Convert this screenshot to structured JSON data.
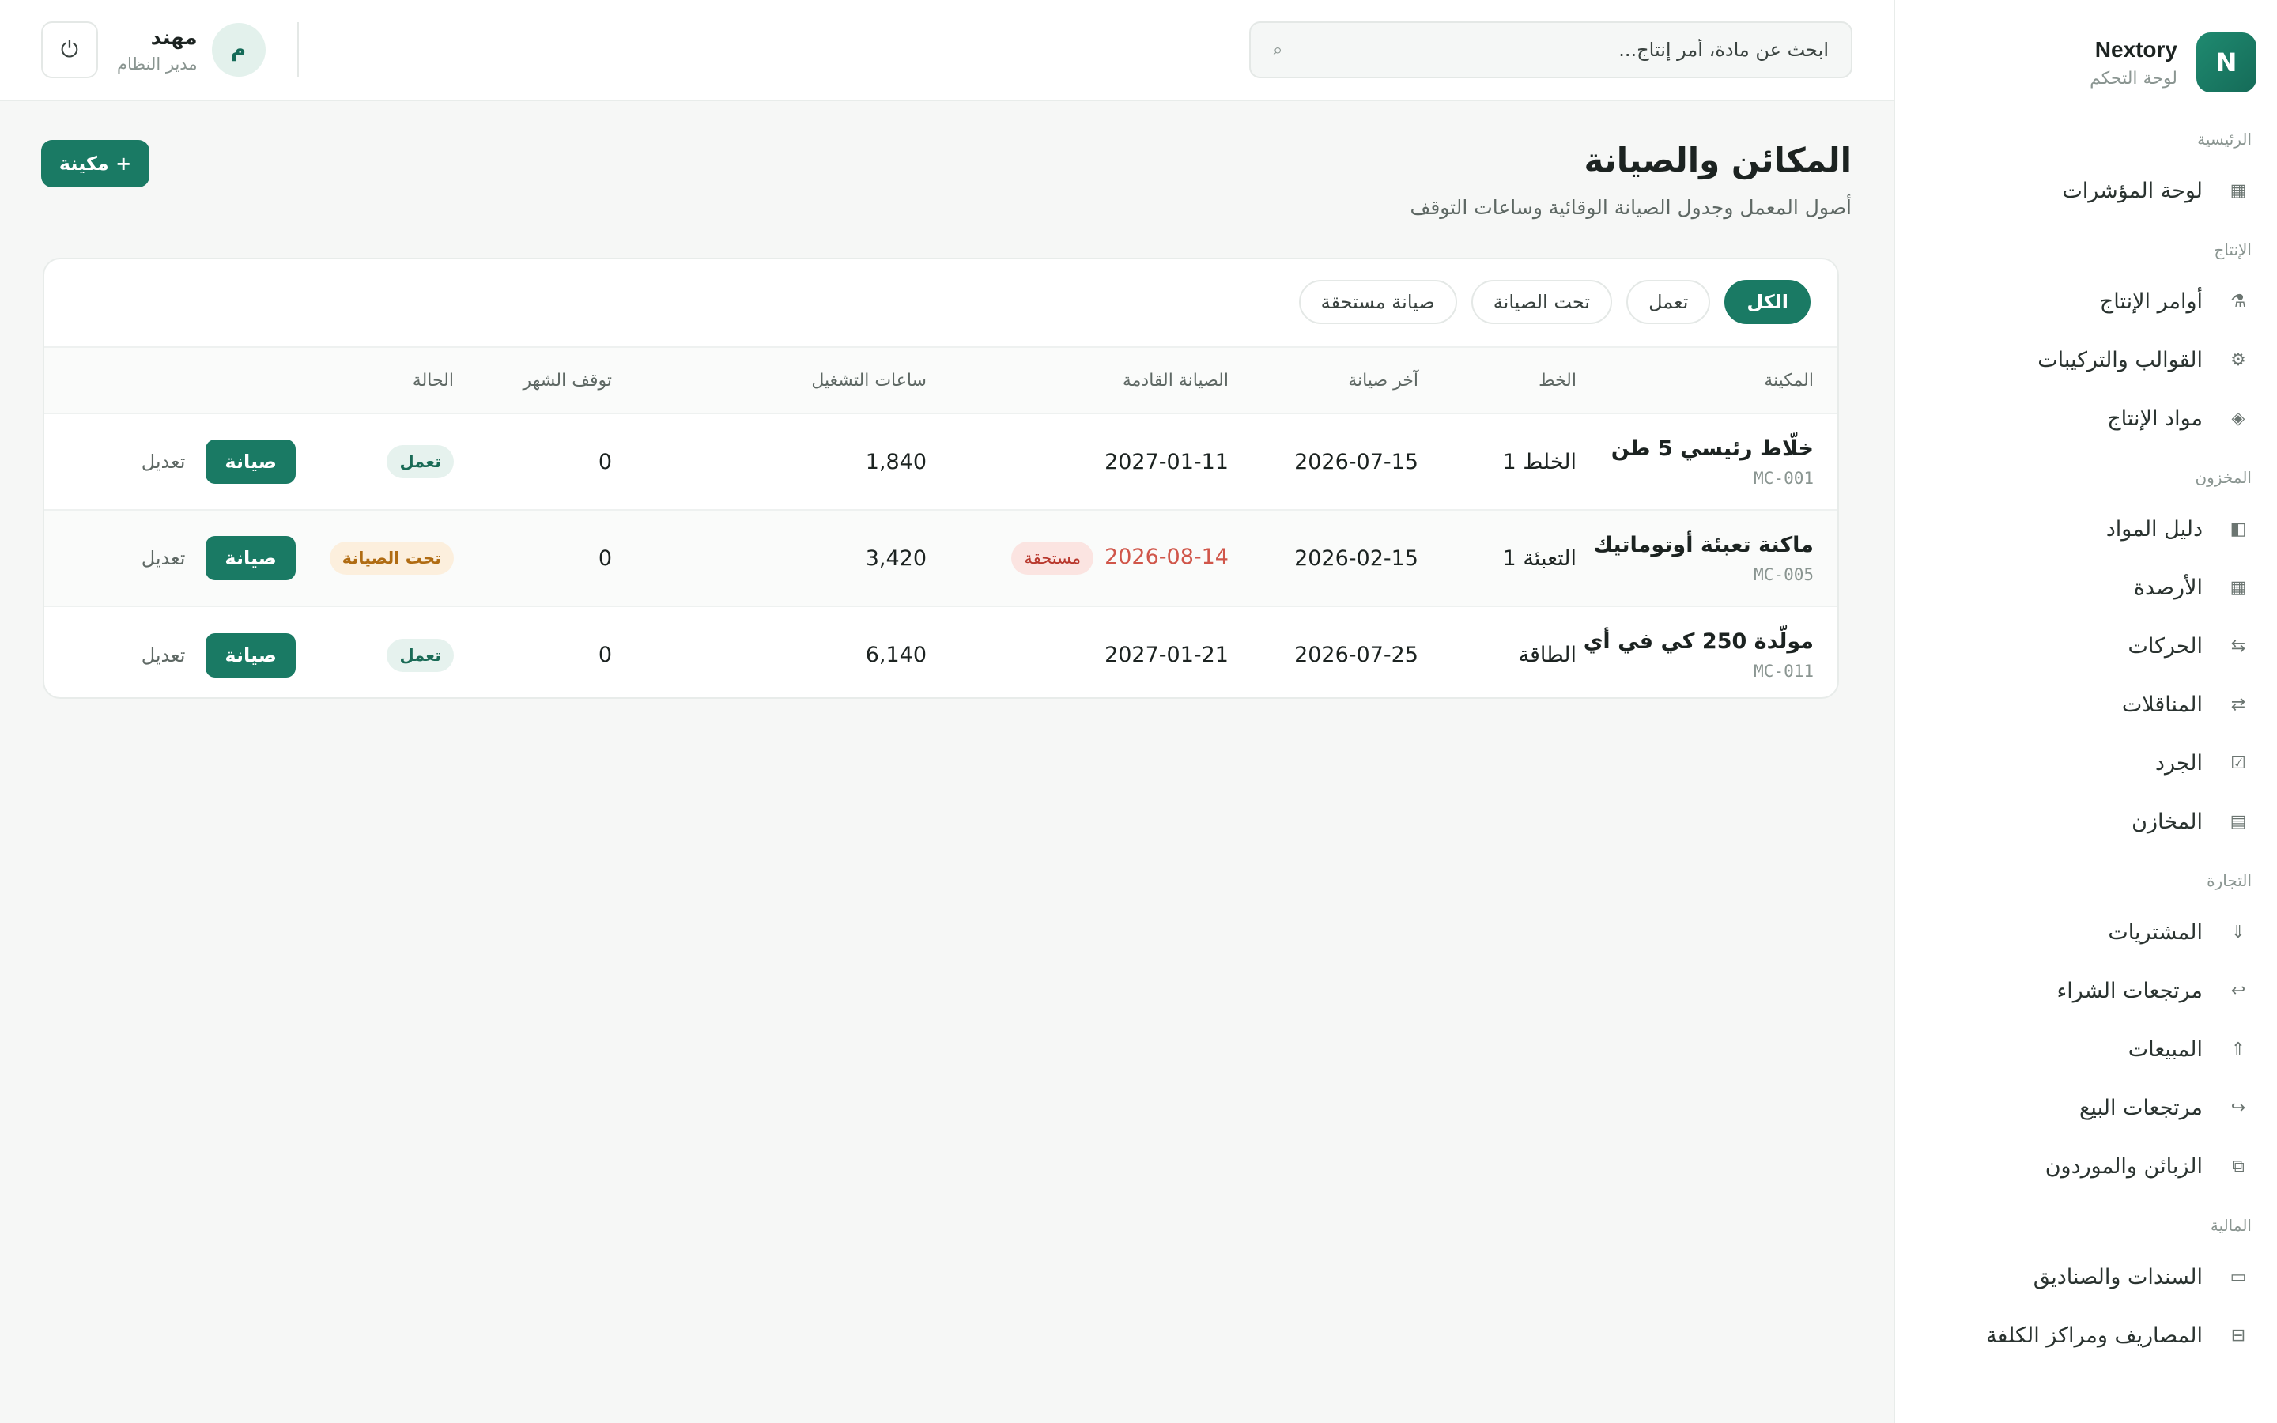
{
  "brand": {
    "logo_letter": "N",
    "name": "Nextory",
    "subtitle": "لوحة التحكم"
  },
  "sidebar": {
    "sections": [
      {
        "title": "الرئيسية",
        "items": [
          {
            "label": "لوحة المؤشرات",
            "icon": "grid-icon",
            "glyph": "▦"
          }
        ]
      },
      {
        "title": "الإنتاج",
        "items": [
          {
            "label": "أوامر الإنتاج",
            "icon": "factory-icon",
            "glyph": "⚗"
          },
          {
            "label": "القوالب والتركيبات",
            "icon": "gear-icon",
            "glyph": "⚙"
          },
          {
            "label": "مواد الإنتاج",
            "icon": "diamond-icon",
            "glyph": "◈"
          }
        ]
      },
      {
        "title": "المخزون",
        "items": [
          {
            "label": "دليل المواد",
            "icon": "book-icon",
            "glyph": "◧"
          },
          {
            "label": "الأرصدة",
            "icon": "grid-icon",
            "glyph": "▦"
          },
          {
            "label": "الحركات",
            "icon": "movements-icon",
            "glyph": "⇆"
          },
          {
            "label": "المناقلات",
            "icon": "transfer-icon",
            "glyph": "⇄"
          },
          {
            "label": "الجرد",
            "icon": "checkbox-icon",
            "glyph": "☑"
          },
          {
            "label": "المخازن",
            "icon": "warehouse-icon",
            "glyph": "▤"
          }
        ]
      },
      {
        "title": "التجارة",
        "items": [
          {
            "label": "المشتريات",
            "icon": "arrow-down-icon",
            "glyph": "⇓"
          },
          {
            "label": "مرتجعات الشراء",
            "icon": "return-icon",
            "glyph": "↩"
          },
          {
            "label": "المبيعات",
            "icon": "arrow-up-icon",
            "glyph": "⇑"
          },
          {
            "label": "مرتجعات البيع",
            "icon": "return-forward-icon",
            "glyph": "↪"
          },
          {
            "label": "الزبائن والموردون",
            "icon": "people-icon",
            "glyph": "⧉"
          }
        ]
      },
      {
        "title": "المالية",
        "items": [
          {
            "label": "السندات والصناديق",
            "icon": "cash-icon",
            "glyph": "▭"
          },
          {
            "label": "المصاريف ومراكز الكلفة",
            "icon": "expense-icon",
            "glyph": "⊟"
          }
        ]
      }
    ]
  },
  "header": {
    "search": {
      "placeholder": "ابحث عن مادة، أمر إنتاج..."
    },
    "user": {
      "name": "مهند",
      "role": "مدير النظام",
      "initial": "م"
    }
  },
  "page": {
    "title": "المكائن والصيانة",
    "subtitle": "أصول المعمل وجدول الصيانة الوقائية وساعات التوقف",
    "add_button": "+ مكينة"
  },
  "filters": [
    {
      "label": "الكل",
      "active": true
    },
    {
      "label": "تعمل",
      "active": false
    },
    {
      "label": "تحت الصيانة",
      "active": false
    },
    {
      "label": "صيانة مستحقة",
      "active": false
    }
  ],
  "table": {
    "columns": [
      "المكينة",
      "الخط",
      "آخر صيانة",
      "الصيانة القادمة",
      "ساعات التشغيل",
      "توقف الشهر",
      "الحالة"
    ],
    "rows": [
      {
        "name": "خلّاط رئيسي 5 طن",
        "code": "MC-001",
        "line": "الخلط 1",
        "last": "2026-07-15",
        "next": "2027-01-11",
        "next_due": false,
        "due_label": "",
        "hours": "1,840",
        "downtime": "0",
        "status": "تعمل",
        "status_type": "work"
      },
      {
        "name": "ماكنة تعبئة أوتوماتيك",
        "code": "MC-005",
        "line": "التعبئة 1",
        "last": "2026-02-15",
        "next": "2026-08-14",
        "next_due": true,
        "due_label": "مستحقة",
        "hours": "3,420",
        "downtime": "0",
        "status": "تحت الصيانة",
        "status_type": "maint"
      },
      {
        "name": "مولّدة 250 كي في أي",
        "code": "MC-011",
        "line": "الطاقة",
        "last": "2026-07-25",
        "next": "2027-01-21",
        "next_due": false,
        "due_label": "",
        "hours": "6,140",
        "downtime": "0",
        "status": "تعمل",
        "status_type": "work"
      }
    ],
    "maint_button": "صيانة",
    "edit_button": "تعديل"
  },
  "colors": {
    "accent": "#1a7a64",
    "due": "#d0564a",
    "maint_badge": "#fcefdd",
    "work_badge": "#e6f2ee"
  }
}
